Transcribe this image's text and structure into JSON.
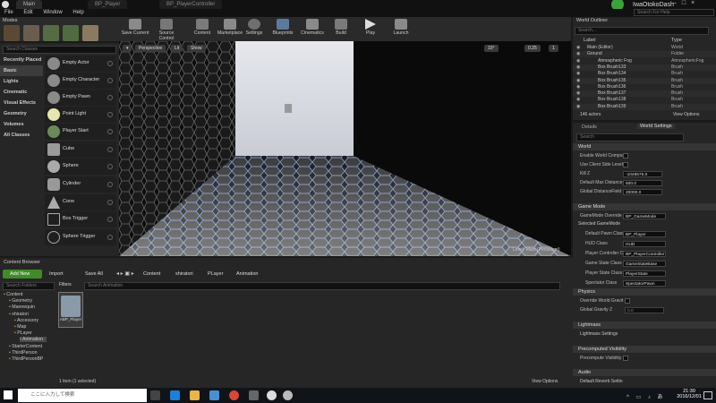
{
  "tabs": [
    {
      "label": "Main"
    },
    {
      "label": "BP_Player"
    },
    {
      "label": "BP_PlayerController"
    }
  ],
  "project_name": "IwaOtokoDash",
  "help_search_placeholder": "Search For Help",
  "menu": [
    "File",
    "Edit",
    "Window",
    "Help"
  ],
  "modes_title": "Modes",
  "search_classes_placeholder": "Search Classes",
  "categories": [
    "Recently Placed",
    "Basic",
    "Lights",
    "Cinematic",
    "Visual Effects",
    "Geometry",
    "Volumes",
    "All Classes"
  ],
  "place_items": [
    "Empty Actor",
    "Empty Character",
    "Empty Pawn",
    "Point Light",
    "Player Start",
    "Cube",
    "Sphere",
    "Cylinder",
    "Cone",
    "Box Trigger",
    "Sphere Trigger"
  ],
  "toolbar": [
    "Save Current",
    "Source Control",
    "Content",
    "Marketplace",
    "Settings",
    "Blueprints",
    "Cinematics",
    "Build",
    "Play",
    "Launch"
  ],
  "viewport": {
    "perspective": "Perspective",
    "lit": "Lit",
    "show": "Show",
    "snap_angle": "10°",
    "scale": "0.25",
    "cam_speed": "1",
    "level_label": "Level:  Main (Persistent)"
  },
  "outliner": {
    "title": "World Outliner",
    "search_placeholder": "Search...",
    "col_label": "Label",
    "col_type": "Type",
    "rows": [
      {
        "label": "Main (Editor)",
        "type": "World"
      },
      {
        "label": "Ground",
        "type": "Folder"
      },
      {
        "label": "Atmospheric Fog",
        "type": "AtmosphericFog"
      },
      {
        "label": "Box Brush133",
        "type": "Brush"
      },
      {
        "label": "Box Brush134",
        "type": "Brush"
      },
      {
        "label": "Box Brush135",
        "type": "Brush"
      },
      {
        "label": "Box Brush136",
        "type": "Brush"
      },
      {
        "label": "Box Brush137",
        "type": "Brush"
      },
      {
        "label": "Box Brush138",
        "type": "Brush"
      },
      {
        "label": "Box Brush139",
        "type": "Brush"
      }
    ],
    "count": "146 actors",
    "view_options": "View Options"
  },
  "details": {
    "tab_details": "Details",
    "tab_world": "World Settings",
    "search_placeholder": "Search",
    "sections": {
      "world": "World",
      "game_mode": "Game Mode",
      "selected_game_mode": "Selected GameMode",
      "physics": "Physics",
      "lightmass": "Lightmass",
      "lightmass_settings": "Lightmass Settings",
      "precomputed": "Precomputed Visibility",
      "audio": "Audio",
      "default_reverb": "Default Reverb Settin"
    },
    "props": [
      {
        "k": "Enable World Compos"
      },
      {
        "k": "Use Client Side Level"
      },
      {
        "k": "Kill Z",
        "v": "-1048575.0"
      },
      {
        "k": "Default Max Distance",
        "v": "500.0"
      },
      {
        "k": "Global DistanceField",
        "v": "20000.0"
      }
    ],
    "gm_override": {
      "k": "GameMode Override",
      "v": "BP_GameMode"
    },
    "gm_props": [
      {
        "k": "Default Pawn Class",
        "v": "BP_Player"
      },
      {
        "k": "HUD Class",
        "v": "HUD"
      },
      {
        "k": "Player Controller Cl",
        "v": "BP_PlayerController"
      },
      {
        "k": "Game State Class",
        "v": "GameStateBase"
      },
      {
        "k": "Player State Class",
        "v": "PlayerState"
      },
      {
        "k": "Spectator Class",
        "v": "SpectatorPawn"
      }
    ],
    "physics_props": [
      {
        "k": "Override World Gravit"
      },
      {
        "k": "Global Gravity Z",
        "v": "0.0"
      }
    ],
    "precomputed_prop": "Precompute Visibility"
  },
  "content_browser": {
    "title": "Content Browser",
    "add_new": "Add New",
    "import": "Import",
    "save_all": "Save All",
    "breadcrumb": [
      "Content",
      "shiratori",
      "PLayer",
      "Animation"
    ],
    "filters": "Filters",
    "search_assets": "Search Animation",
    "search_folders": "Search Folders",
    "tree": [
      "Content",
      "Geometry",
      "Mannequin",
      "shiratori",
      "Accessory",
      "Map",
      "PLayer",
      "Animation",
      "StarterContent",
      "ThirdPerson",
      "ThirdPersonBP"
    ],
    "asset_label": "ABP_Player",
    "status": "1 item (1 selected)",
    "view_options": "View Options"
  },
  "taskbar": {
    "search_placeholder": "ここに入力して検索",
    "time": "21:30",
    "date": "2016/12/01"
  }
}
